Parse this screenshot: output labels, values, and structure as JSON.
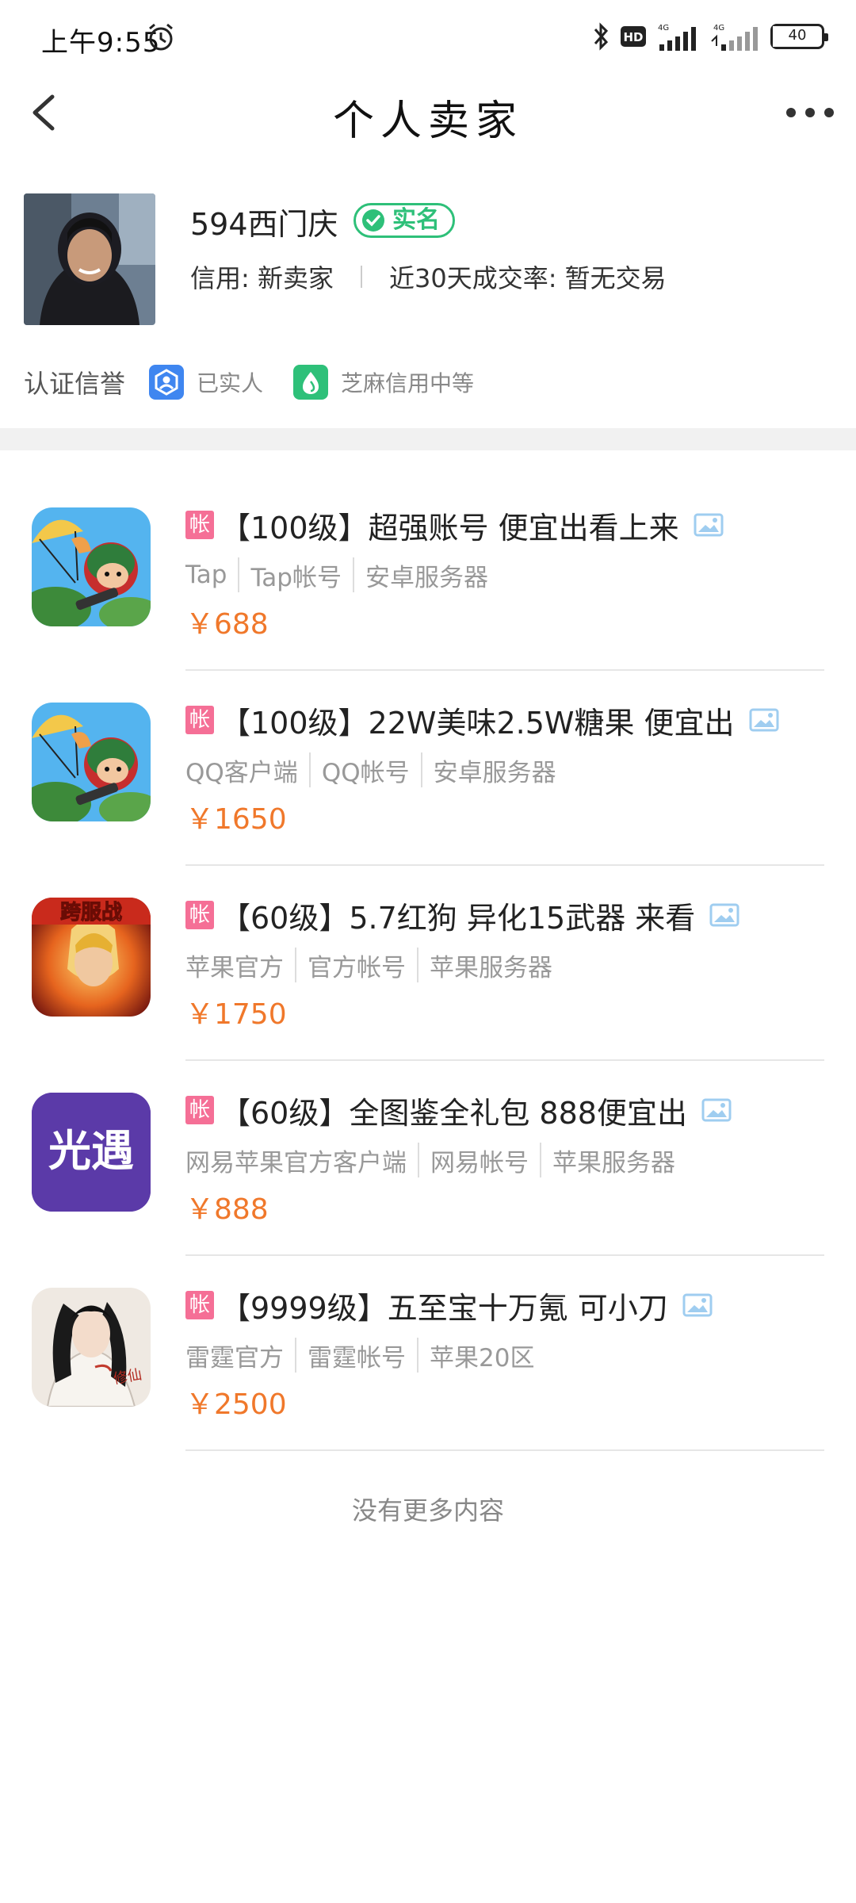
{
  "status_bar": {
    "time": "上午9:55",
    "battery": "40",
    "icons": [
      "bluetooth-icon",
      "hd-icon",
      "signal-4g-icon",
      "signal-4g-icon",
      "battery-icon"
    ]
  },
  "nav": {
    "title": "个人卖家"
  },
  "seller": {
    "name": "594西门庆",
    "verified_label": "实名",
    "credit": "信用: 新卖家",
    "trade_rate": "近30天成交率: 暂无交易"
  },
  "certification": {
    "label": "认证信誉",
    "items": [
      {
        "text": "已实人",
        "icon": "real-person-icon",
        "color": "#3f86f0"
      },
      {
        "text": "芝麻信用中等",
        "icon": "sesame-credit-icon",
        "color": "#2ec079"
      }
    ]
  },
  "listings": [
    {
      "tag": "帐",
      "title": "【100级】超强账号 便宜出看上来",
      "attrs": [
        "Tap",
        "Tap帐号",
        "安卓服务器"
      ],
      "price": "￥688",
      "thumb": "parachute-game-icon"
    },
    {
      "tag": "帐",
      "title": "【100级】22W美味2.5W糖果 便宜出",
      "attrs": [
        "QQ客户端",
        "QQ帐号",
        "安卓服务器"
      ],
      "price": "￥1650",
      "thumb": "parachute-game-icon"
    },
    {
      "tag": "帐",
      "title": "【60级】5.7红狗 异化15武器 来看",
      "attrs": [
        "苹果官方",
        "官方帐号",
        "苹果服务器"
      ],
      "price": "￥1750",
      "thumb": "cross-server-battle-icon",
      "thumb_text": "跨服战"
    },
    {
      "tag": "帐",
      "title": "【60级】全图鉴全礼包 888便宜出",
      "attrs": [
        "网易苹果官方客户端",
        "网易帐号",
        "苹果服务器"
      ],
      "price": "￥888",
      "thumb": "sky-guangyu-icon",
      "thumb_text": "光遇"
    },
    {
      "tag": "帐",
      "title": "【9999级】五至宝十万氪 可小刀",
      "attrs": [
        "雷霆官方",
        "雷霆帐号",
        "苹果20区"
      ],
      "price": "￥2500",
      "thumb": "xiuxian-game-icon",
      "thumb_text": "修仙"
    }
  ],
  "footer": {
    "no_more": "没有更多内容"
  },
  "colors": {
    "price": "#f0782b",
    "tag_bg": "#f56f96",
    "verified": "#2ec079",
    "accent_blue": "#3f86f0"
  }
}
